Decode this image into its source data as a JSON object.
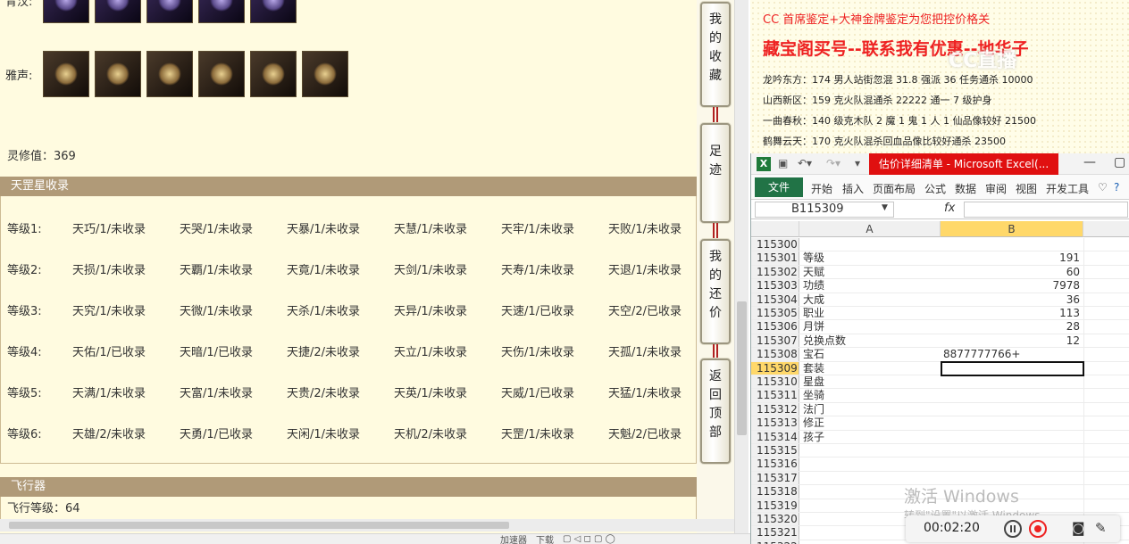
{
  "game": {
    "qing_label": "青汉:",
    "ya_label": "雅声:",
    "lingxiu": "灵修值：369",
    "star_section_title": "天罡星收录",
    "star_rows": [
      {
        "level": "等级1:",
        "cells": [
          "天巧/1/未收录",
          "天哭/1/未收录",
          "天暴/1/未收录",
          "天慧/1/未收录",
          "天牢/1/未收录",
          "天败/1/未收录"
        ]
      },
      {
        "level": "等级2:",
        "cells": [
          "天损/1/未收录",
          "天覇/1/未收录",
          "天竟/1/未收录",
          "天剑/1/未收录",
          "天寿/1/未收录",
          "天退/1/未收录"
        ]
      },
      {
        "level": "等级3:",
        "cells": [
          "天究/1/未收录",
          "天微/1/未收录",
          "天杀/1/未收录",
          "天异/1/未收录",
          "天速/1/已收录",
          "天空/2/已收录"
        ]
      },
      {
        "level": "等级4:",
        "cells": [
          "天佑/1/已收录",
          "天暗/1/已收录",
          "天捷/2/未收录",
          "天立/1/未收录",
          "天伤/1/未收录",
          "天孤/1/未收录"
        ]
      },
      {
        "level": "等级5:",
        "cells": [
          "天满/1/未收录",
          "天富/1/未收录",
          "天贵/2/未收录",
          "天英/1/未收录",
          "天威/1/已收录",
          "天猛/1/未收录"
        ]
      },
      {
        "level": "等级6:",
        "cells": [
          "天雄/2/未收录",
          "天勇/1/已收录",
          "天闲/1/未收录",
          "天机/2/未收录",
          "天罡/1/未收录",
          "天魁/2/已收录"
        ]
      }
    ],
    "fly_section_title": "飞行器",
    "fly_level": "飞行等级：64"
  },
  "side_buttons": [
    {
      "label": "我的收藏"
    },
    {
      "label": "足迹"
    },
    {
      "label": "我的还价"
    },
    {
      "label": "返回顶部"
    }
  ],
  "bottom_bar": {
    "speed": "加速器",
    "download": "下载"
  },
  "ad": {
    "top_line": "CC 首席鉴定+大神金牌鉴定为您把控价格关",
    "headline": "藏宝阁买号--联系我有优惠--地华子",
    "lines": [
      "龙吟东方：174 男人站街忽混 31.8 强派 36 任务通杀 10000",
      "山西新区：159 克火队混通杀 22222 通一 7 级护身",
      "一曲春秋：140 级克木队 2 魔 1 鬼 1 人 1 仙品像较好 21500",
      "鹤舞云天：170 克火队混杀回血品像比较好通杀 23500"
    ],
    "watermark": "CC直播"
  },
  "excel": {
    "window_title": "估价详细清单 - Microsoft Excel(...",
    "file_tab": "文件",
    "tabs": [
      "开始",
      "插入",
      "页面布局",
      "公式",
      "数据",
      "审阅",
      "视图",
      "开发工具"
    ],
    "name_box": "B115309",
    "fx": "fx",
    "col_a": "A",
    "col_b": "B",
    "rows": [
      {
        "num": "115300",
        "a": "",
        "b": ""
      },
      {
        "num": "115301",
        "a": "等级",
        "b": "191"
      },
      {
        "num": "115302",
        "a": "天赋",
        "b": "60"
      },
      {
        "num": "115303",
        "a": "功绩",
        "b": "7978"
      },
      {
        "num": "115304",
        "a": "大成",
        "b": "36"
      },
      {
        "num": "115305",
        "a": "职业",
        "b": "113"
      },
      {
        "num": "115306",
        "a": "月饼",
        "b": "28"
      },
      {
        "num": "115307",
        "a": "兑换点数",
        "b": "12"
      },
      {
        "num": "115308",
        "a": "宝石",
        "b": "8877777766+"
      },
      {
        "num": "115309",
        "a": "套装",
        "b": ""
      },
      {
        "num": "115310",
        "a": "星盘",
        "b": ""
      },
      {
        "num": "115311",
        "a": "坐骑",
        "b": ""
      },
      {
        "num": "115312",
        "a": "法门",
        "b": ""
      },
      {
        "num": "115313",
        "a": "修正",
        "b": ""
      },
      {
        "num": "115314",
        "a": "孩子",
        "b": ""
      },
      {
        "num": "115315",
        "a": "",
        "b": ""
      },
      {
        "num": "115316",
        "a": "",
        "b": ""
      },
      {
        "num": "115317",
        "a": "",
        "b": ""
      },
      {
        "num": "115318",
        "a": "",
        "b": ""
      },
      {
        "num": "115319",
        "a": "",
        "b": ""
      },
      {
        "num": "115320",
        "a": "",
        "b": ""
      },
      {
        "num": "115321",
        "a": "",
        "b": ""
      },
      {
        "num": "115322",
        "a": "",
        "b": ""
      }
    ]
  },
  "os": {
    "activate_title": "激活 Windows",
    "activate_sub": "转到\"设置\"以激活 Windows。"
  },
  "recorder": {
    "time": "00:02:20"
  }
}
